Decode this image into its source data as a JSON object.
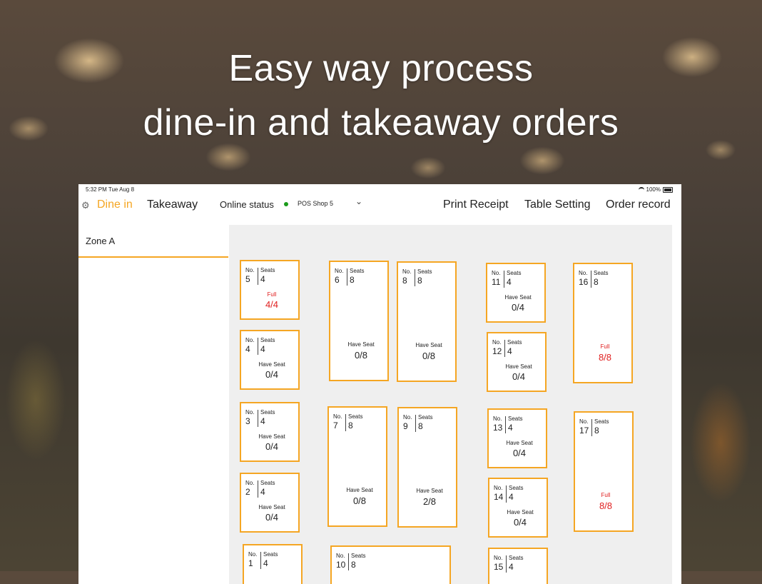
{
  "headline": {
    "line1": "Easy way process",
    "line2": "dine-in and takeaway orders"
  },
  "statusbar": {
    "time": "5:32 PM  Tue Aug 8",
    "battery": "100%"
  },
  "nav": {
    "dine_in": "Dine in",
    "takeaway": "Takeaway",
    "online_status": "Online status",
    "shop": "POS Shop 5",
    "print_receipt": "Print Receipt",
    "table_setting": "Table Setting",
    "order_record": "Order record"
  },
  "colors": {
    "accent": "#f5a623",
    "online": "#1a9b1a",
    "full": "#e02020"
  },
  "zone": {
    "label": "Zone A"
  },
  "labels": {
    "no": "No.",
    "seats": "Seats"
  },
  "tables": [
    {
      "no": "5",
      "seats": "4",
      "status": "Full",
      "occupancy": "4/4"
    },
    {
      "no": "4",
      "seats": "4",
      "status": "Have Seat",
      "occupancy": "0/4"
    },
    {
      "no": "3",
      "seats": "4",
      "status": "Have Seat",
      "occupancy": "0/4"
    },
    {
      "no": "2",
      "seats": "4",
      "status": "Have Seat",
      "occupancy": "0/4"
    },
    {
      "no": "1",
      "seats": "4",
      "status": "",
      "occupancy": ""
    },
    {
      "no": "6",
      "seats": "8",
      "status": "Have Seat",
      "occupancy": "0/8"
    },
    {
      "no": "8",
      "seats": "8",
      "status": "Have Seat",
      "occupancy": "0/8"
    },
    {
      "no": "7",
      "seats": "8",
      "status": "Have Seat",
      "occupancy": "0/8"
    },
    {
      "no": "9",
      "seats": "8",
      "status": "Have Seat",
      "occupancy": "2/8"
    },
    {
      "no": "10",
      "seats": "8",
      "status": "",
      "occupancy": ""
    },
    {
      "no": "11",
      "seats": "4",
      "status": "Have Seat",
      "occupancy": "0/4"
    },
    {
      "no": "12",
      "seats": "4",
      "status": "Have Seat",
      "occupancy": "0/4"
    },
    {
      "no": "13",
      "seats": "4",
      "status": "Have Seat",
      "occupancy": "0/4"
    },
    {
      "no": "14",
      "seats": "4",
      "status": "Have Seat",
      "occupancy": "0/4"
    },
    {
      "no": "15",
      "seats": "4",
      "status": "",
      "occupancy": ""
    },
    {
      "no": "16",
      "seats": "8",
      "status": "Full",
      "occupancy": "8/8"
    },
    {
      "no": "17",
      "seats": "8",
      "status": "Full",
      "occupancy": "8/8"
    }
  ]
}
